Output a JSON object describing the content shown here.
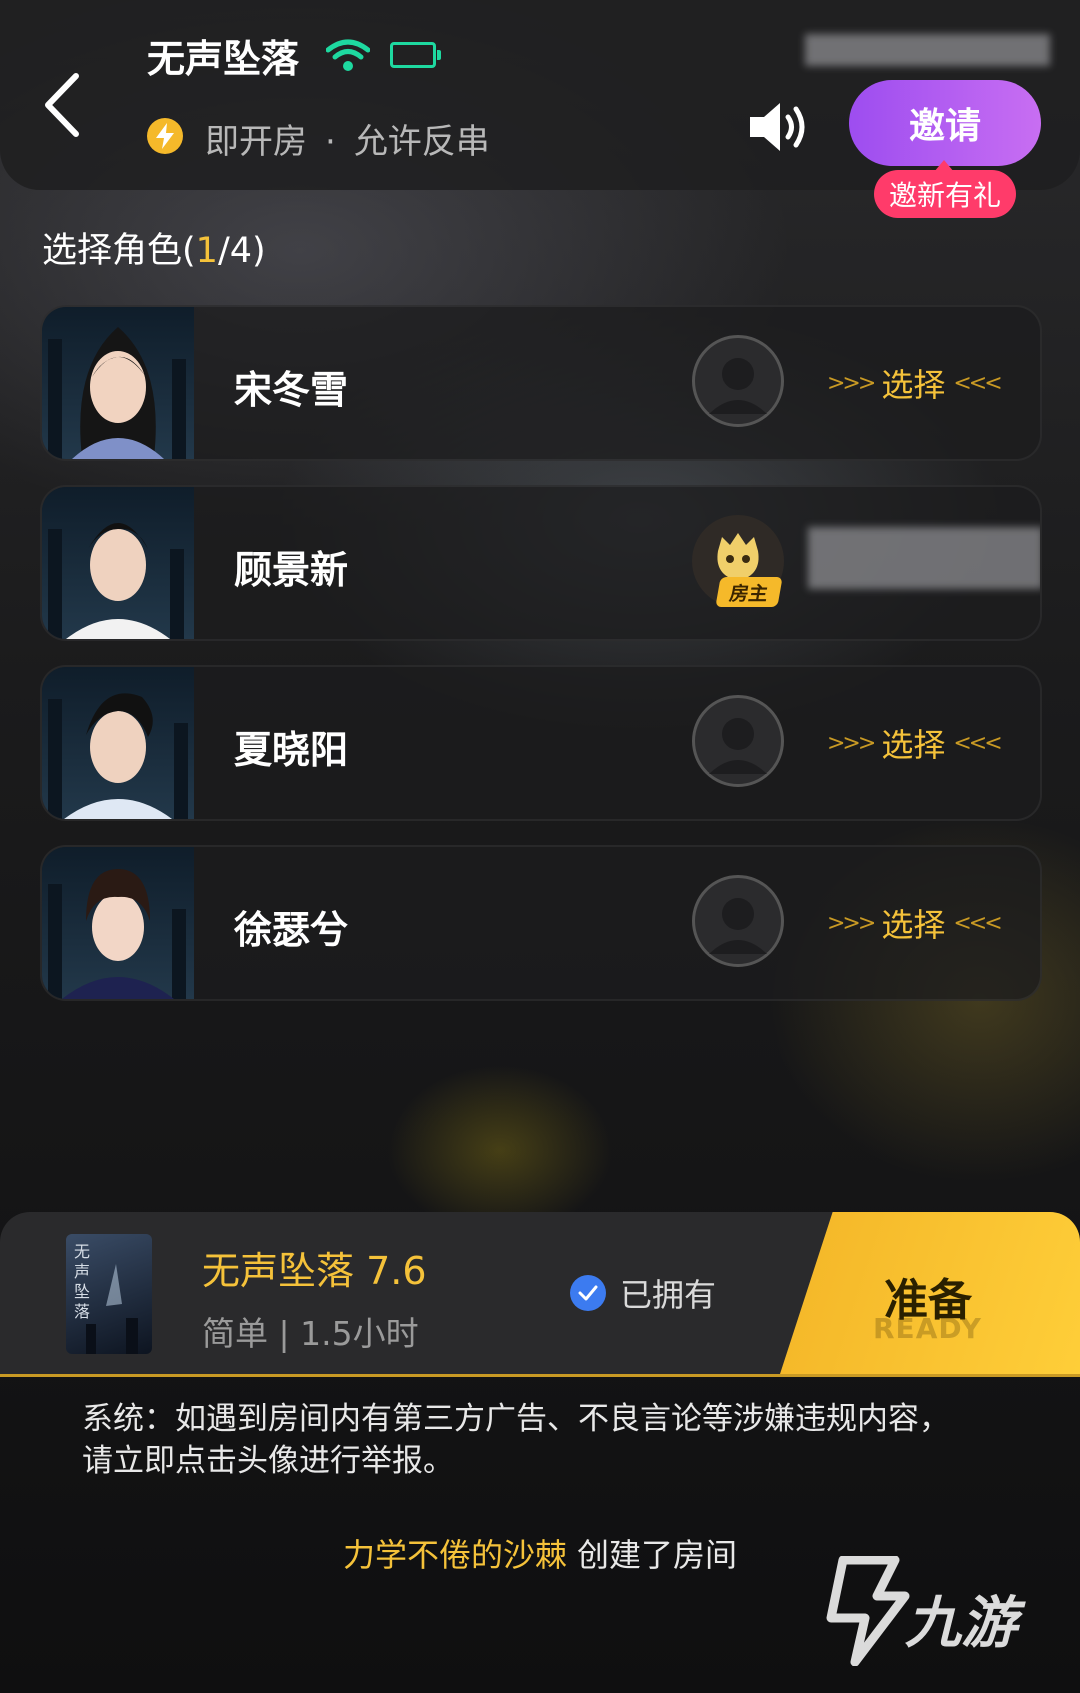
{
  "header": {
    "title": "无声坠落",
    "room_type": "即开房",
    "separator": "·",
    "room_rule": "允许反串",
    "invite_label": "邀请",
    "invite_badge": "邀新有礼"
  },
  "roles": {
    "title_prefix": "选择角色(",
    "selected": "1",
    "title_suffix": "/4)",
    "items": [
      {
        "name": "宋冬雪",
        "select_label": "选择",
        "occupied": false
      },
      {
        "name": "顾景新",
        "host_badge": "房主",
        "occupied": true
      },
      {
        "name": "夏晓阳",
        "select_label": "选择",
        "occupied": false
      },
      {
        "name": "徐瑟兮",
        "select_label": "选择",
        "occupied": false
      }
    ]
  },
  "game": {
    "cover_text": "无声坠落",
    "title": "无声坠落 7.6",
    "meta": "简单 | 1.5小时",
    "owned_label": "已拥有",
    "ready_label": "准备",
    "ready_sub": "READY"
  },
  "messages": {
    "system": "系统：如遇到房间内有第三方广告、不良言论等涉嫌违规内容，请立即点击头像进行举报。",
    "creator_name": "力学不倦的沙棘",
    "creator_action": "创建了房间"
  },
  "watermark": {
    "text": "九游"
  },
  "colors": {
    "accent": "#f5c23a",
    "invite": "#b45cf1",
    "badge": "#ff3b6a",
    "wifi": "#1ed9a0"
  }
}
